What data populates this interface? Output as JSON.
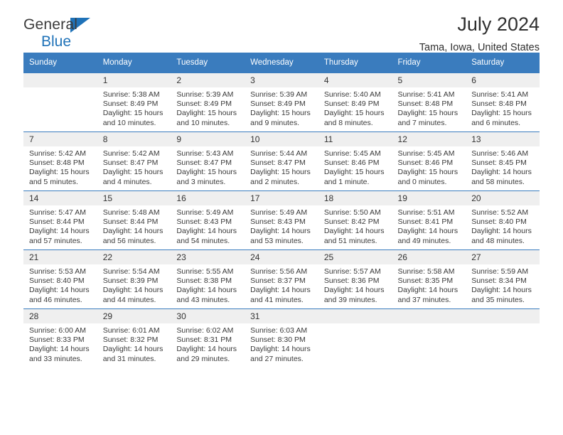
{
  "brand": {
    "line1": "General",
    "line2": "Blue",
    "accent_color": "#1f72b8"
  },
  "header": {
    "title": "July 2024",
    "location": "Tama, Iowa, United States"
  },
  "calendar": {
    "header_bg": "#3a7cbe",
    "daynum_bg": "#efefef",
    "weekday_headers": [
      "Sunday",
      "Monday",
      "Tuesday",
      "Wednesday",
      "Thursday",
      "Friday",
      "Saturday"
    ],
    "weeks": [
      [
        {
          "day": "",
          "sunrise": "",
          "sunset": "",
          "daylight": ""
        },
        {
          "day": "1",
          "sunrise": "Sunrise: 5:38 AM",
          "sunset": "Sunset: 8:49 PM",
          "daylight": "Daylight: 15 hours and 10 minutes."
        },
        {
          "day": "2",
          "sunrise": "Sunrise: 5:39 AM",
          "sunset": "Sunset: 8:49 PM",
          "daylight": "Daylight: 15 hours and 10 minutes."
        },
        {
          "day": "3",
          "sunrise": "Sunrise: 5:39 AM",
          "sunset": "Sunset: 8:49 PM",
          "daylight": "Daylight: 15 hours and 9 minutes."
        },
        {
          "day": "4",
          "sunrise": "Sunrise: 5:40 AM",
          "sunset": "Sunset: 8:49 PM",
          "daylight": "Daylight: 15 hours and 8 minutes."
        },
        {
          "day": "5",
          "sunrise": "Sunrise: 5:41 AM",
          "sunset": "Sunset: 8:48 PM",
          "daylight": "Daylight: 15 hours and 7 minutes."
        },
        {
          "day": "6",
          "sunrise": "Sunrise: 5:41 AM",
          "sunset": "Sunset: 8:48 PM",
          "daylight": "Daylight: 15 hours and 6 minutes."
        }
      ],
      [
        {
          "day": "7",
          "sunrise": "Sunrise: 5:42 AM",
          "sunset": "Sunset: 8:48 PM",
          "daylight": "Daylight: 15 hours and 5 minutes."
        },
        {
          "day": "8",
          "sunrise": "Sunrise: 5:42 AM",
          "sunset": "Sunset: 8:47 PM",
          "daylight": "Daylight: 15 hours and 4 minutes."
        },
        {
          "day": "9",
          "sunrise": "Sunrise: 5:43 AM",
          "sunset": "Sunset: 8:47 PM",
          "daylight": "Daylight: 15 hours and 3 minutes."
        },
        {
          "day": "10",
          "sunrise": "Sunrise: 5:44 AM",
          "sunset": "Sunset: 8:47 PM",
          "daylight": "Daylight: 15 hours and 2 minutes."
        },
        {
          "day": "11",
          "sunrise": "Sunrise: 5:45 AM",
          "sunset": "Sunset: 8:46 PM",
          "daylight": "Daylight: 15 hours and 1 minute."
        },
        {
          "day": "12",
          "sunrise": "Sunrise: 5:45 AM",
          "sunset": "Sunset: 8:46 PM",
          "daylight": "Daylight: 15 hours and 0 minutes."
        },
        {
          "day": "13",
          "sunrise": "Sunrise: 5:46 AM",
          "sunset": "Sunset: 8:45 PM",
          "daylight": "Daylight: 14 hours and 58 minutes."
        }
      ],
      [
        {
          "day": "14",
          "sunrise": "Sunrise: 5:47 AM",
          "sunset": "Sunset: 8:44 PM",
          "daylight": "Daylight: 14 hours and 57 minutes."
        },
        {
          "day": "15",
          "sunrise": "Sunrise: 5:48 AM",
          "sunset": "Sunset: 8:44 PM",
          "daylight": "Daylight: 14 hours and 56 minutes."
        },
        {
          "day": "16",
          "sunrise": "Sunrise: 5:49 AM",
          "sunset": "Sunset: 8:43 PM",
          "daylight": "Daylight: 14 hours and 54 minutes."
        },
        {
          "day": "17",
          "sunrise": "Sunrise: 5:49 AM",
          "sunset": "Sunset: 8:43 PM",
          "daylight": "Daylight: 14 hours and 53 minutes."
        },
        {
          "day": "18",
          "sunrise": "Sunrise: 5:50 AM",
          "sunset": "Sunset: 8:42 PM",
          "daylight": "Daylight: 14 hours and 51 minutes."
        },
        {
          "day": "19",
          "sunrise": "Sunrise: 5:51 AM",
          "sunset": "Sunset: 8:41 PM",
          "daylight": "Daylight: 14 hours and 49 minutes."
        },
        {
          "day": "20",
          "sunrise": "Sunrise: 5:52 AM",
          "sunset": "Sunset: 8:40 PM",
          "daylight": "Daylight: 14 hours and 48 minutes."
        }
      ],
      [
        {
          "day": "21",
          "sunrise": "Sunrise: 5:53 AM",
          "sunset": "Sunset: 8:40 PM",
          "daylight": "Daylight: 14 hours and 46 minutes."
        },
        {
          "day": "22",
          "sunrise": "Sunrise: 5:54 AM",
          "sunset": "Sunset: 8:39 PM",
          "daylight": "Daylight: 14 hours and 44 minutes."
        },
        {
          "day": "23",
          "sunrise": "Sunrise: 5:55 AM",
          "sunset": "Sunset: 8:38 PM",
          "daylight": "Daylight: 14 hours and 43 minutes."
        },
        {
          "day": "24",
          "sunrise": "Sunrise: 5:56 AM",
          "sunset": "Sunset: 8:37 PM",
          "daylight": "Daylight: 14 hours and 41 minutes."
        },
        {
          "day": "25",
          "sunrise": "Sunrise: 5:57 AM",
          "sunset": "Sunset: 8:36 PM",
          "daylight": "Daylight: 14 hours and 39 minutes."
        },
        {
          "day": "26",
          "sunrise": "Sunrise: 5:58 AM",
          "sunset": "Sunset: 8:35 PM",
          "daylight": "Daylight: 14 hours and 37 minutes."
        },
        {
          "day": "27",
          "sunrise": "Sunrise: 5:59 AM",
          "sunset": "Sunset: 8:34 PM",
          "daylight": "Daylight: 14 hours and 35 minutes."
        }
      ],
      [
        {
          "day": "28",
          "sunrise": "Sunrise: 6:00 AM",
          "sunset": "Sunset: 8:33 PM",
          "daylight": "Daylight: 14 hours and 33 minutes."
        },
        {
          "day": "29",
          "sunrise": "Sunrise: 6:01 AM",
          "sunset": "Sunset: 8:32 PM",
          "daylight": "Daylight: 14 hours and 31 minutes."
        },
        {
          "day": "30",
          "sunrise": "Sunrise: 6:02 AM",
          "sunset": "Sunset: 8:31 PM",
          "daylight": "Daylight: 14 hours and 29 minutes."
        },
        {
          "day": "31",
          "sunrise": "Sunrise: 6:03 AM",
          "sunset": "Sunset: 8:30 PM",
          "daylight": "Daylight: 14 hours and 27 minutes."
        },
        {
          "day": "",
          "sunrise": "",
          "sunset": "",
          "daylight": ""
        },
        {
          "day": "",
          "sunrise": "",
          "sunset": "",
          "daylight": ""
        },
        {
          "day": "",
          "sunrise": "",
          "sunset": "",
          "daylight": ""
        }
      ]
    ]
  }
}
